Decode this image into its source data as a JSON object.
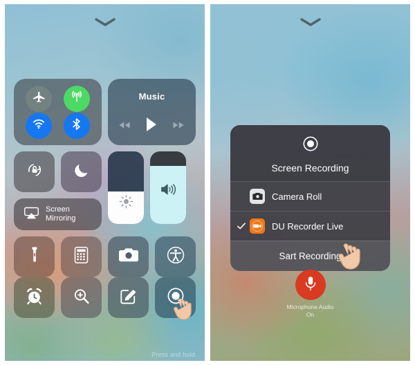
{
  "panels": {
    "left": {
      "name": "ios-control-center",
      "handle_icon": "chevron-down-icon",
      "connectivity": {
        "airplane": {
          "icon": "airplane-icon",
          "label": "Airplane Mode",
          "state": "off"
        },
        "cellular": {
          "icon": "cellular-icon",
          "label": "Cellular Data",
          "state": "on",
          "color": "#4cd964"
        },
        "wifi": {
          "icon": "wifi-icon",
          "label": "Wi-Fi",
          "state": "on",
          "color": "#1578f0"
        },
        "bluetooth": {
          "icon": "bluetooth-icon",
          "label": "Bluetooth",
          "state": "on",
          "color": "#1578f0"
        }
      },
      "music": {
        "title": "Music",
        "prev_icon": "rewind-icon",
        "play_icon": "play-icon",
        "next_icon": "fast-forward-icon"
      },
      "toggles": {
        "rotation_lock": {
          "icon": "rotation-lock-icon",
          "label": "Portrait Orientation Lock"
        },
        "do_not_disturb": {
          "icon": "moon-icon",
          "label": "Do Not Disturb"
        }
      },
      "screen_mirroring": {
        "icon": "airplay-icon",
        "label_line1": "Screen",
        "label_line2": "Mirroring"
      },
      "sliders": {
        "brightness": {
          "icon": "brightness-icon",
          "label": "Brightness",
          "value": 45
        },
        "volume": {
          "icon": "volume-icon",
          "label": "Volume",
          "value": 80
        }
      },
      "shortcuts": [
        {
          "icon": "flashlight-icon",
          "label": "Flashlight"
        },
        {
          "icon": "calculator-icon",
          "label": "Calculator"
        },
        {
          "icon": "camera-icon",
          "label": "Camera"
        },
        {
          "icon": "accessibility-icon",
          "label": "Accessibility"
        },
        {
          "icon": "alarm-clock-icon",
          "label": "Alarm"
        },
        {
          "icon": "magnifier-plus-icon",
          "label": "Magnifier"
        },
        {
          "icon": "notes-icon",
          "label": "Notes"
        },
        {
          "icon": "screen-record-icon",
          "label": "Screen Recording"
        }
      ],
      "hint": "Press and hold",
      "hand_cursor_icon": "pointing-hand-icon"
    },
    "right": {
      "name": "screen-recording-sheet",
      "handle_icon": "chevron-down-icon",
      "sheet": {
        "record_icon": "record-dot-icon",
        "title": "Screen Recording",
        "options": [
          {
            "icon": "camera-roll-icon",
            "label": "Camera Roll",
            "selected": false,
            "icon_color": "#e3e4e6"
          },
          {
            "icon": "du-recorder-icon",
            "label": "DU Recorder Live",
            "selected": true,
            "icon_color": "#f07818"
          }
        ],
        "check_icon": "checkmark-icon",
        "action_label": "Sart Recording",
        "hand_cursor_icon": "pointing-hand-icon"
      },
      "microphone": {
        "icon": "microphone-icon",
        "color": "#d93a22",
        "caption_line1": "Microphone Audio",
        "caption_line2": "On"
      }
    }
  }
}
